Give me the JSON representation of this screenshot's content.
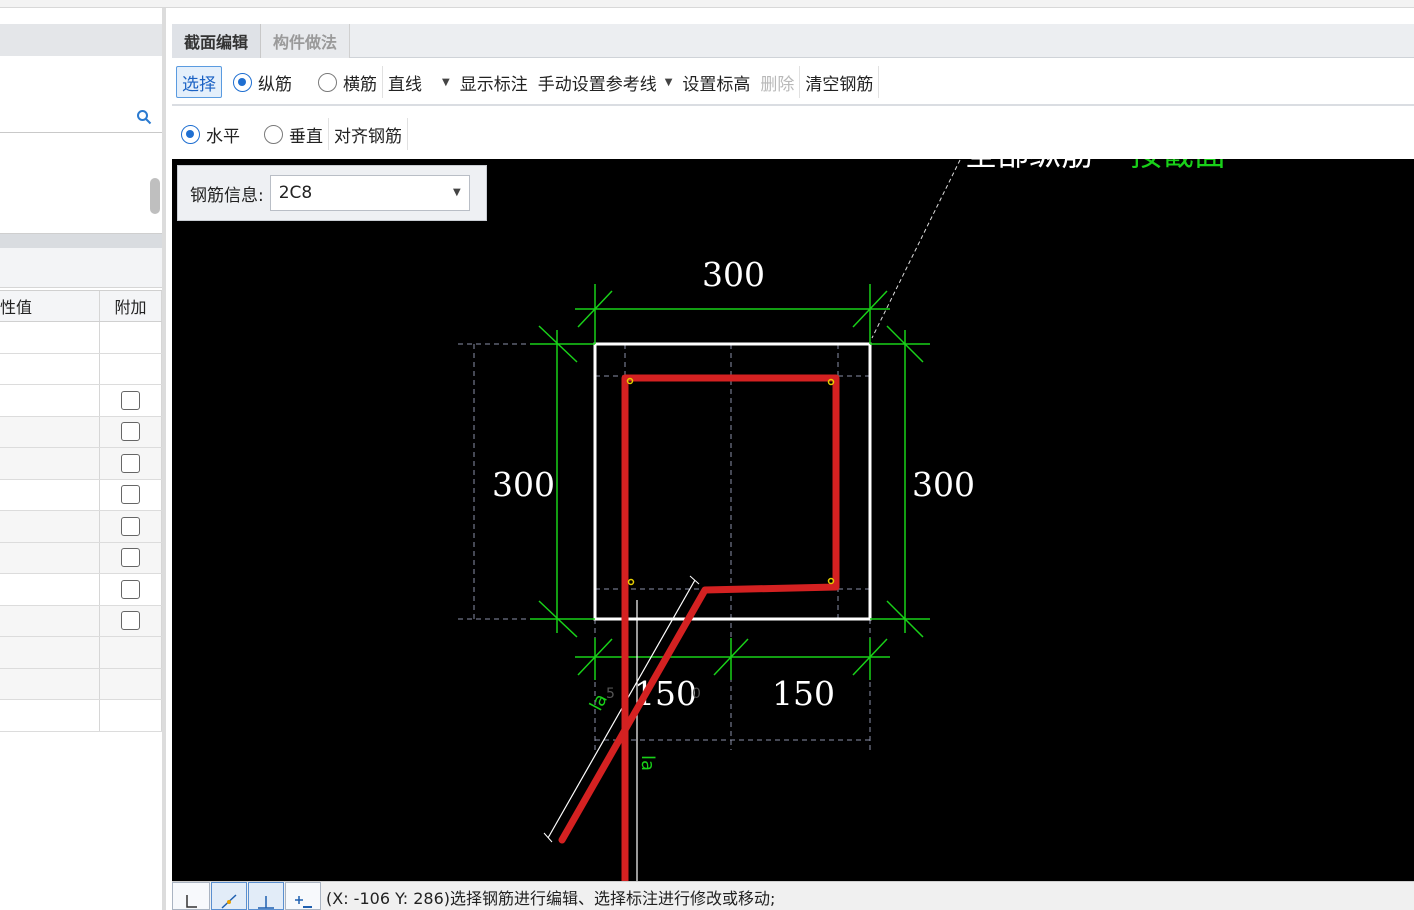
{
  "left_panel": {
    "search_icon": "search-icon",
    "table": {
      "headers": [
        "性值",
        "附加"
      ],
      "rows": [
        {
          "checkbox": false
        },
        {
          "checkbox": false
        },
        {
          "checkbox": true
        },
        {
          "checkbox": true
        },
        {
          "checkbox": true
        },
        {
          "checkbox": true
        },
        {
          "checkbox": true
        },
        {
          "checkbox": true
        },
        {
          "checkbox": true
        },
        {
          "checkbox": true
        },
        {
          "checkbox": false
        },
        {
          "checkbox": false
        },
        {
          "checkbox": false
        }
      ]
    }
  },
  "tabs": [
    {
      "label": "截面编辑",
      "active": true
    },
    {
      "label": "构件做法",
      "active": false
    }
  ],
  "toolbar1": {
    "select": "选择",
    "longitudinal": "纵筋",
    "transverse": "横筋",
    "line": "直线",
    "show_annotation": "显示标注",
    "manual_reference": "手动设置参考线",
    "set_elevation": "设置标高",
    "delete": "删除",
    "clear_rebar": "清空钢筋"
  },
  "toolbar2": {
    "horizontal": "水平",
    "vertical": "垂直",
    "align_rebar": "对齐钢筋"
  },
  "rebar_info": {
    "label": "钢筋信息:",
    "value": "2C8"
  },
  "drawing": {
    "top_label": "全部纵筋",
    "top_label_green": "按截面",
    "dim_top": "300",
    "dim_left": "300",
    "dim_right": "300",
    "dim_bottom_left": "150",
    "dim_bottom_right": "150",
    "la_label_1": "la",
    "la_label_2": "la",
    "small_5": "5",
    "small_0": "0",
    "colors": {
      "rebar": "#d42121",
      "dimension": "#19d119",
      "section": "#ffffff",
      "node": "#e8d000"
    }
  },
  "status": {
    "text": "(X: -106 Y: 286)选择钢筋进行编辑、选择标注进行修改或移动;"
  }
}
